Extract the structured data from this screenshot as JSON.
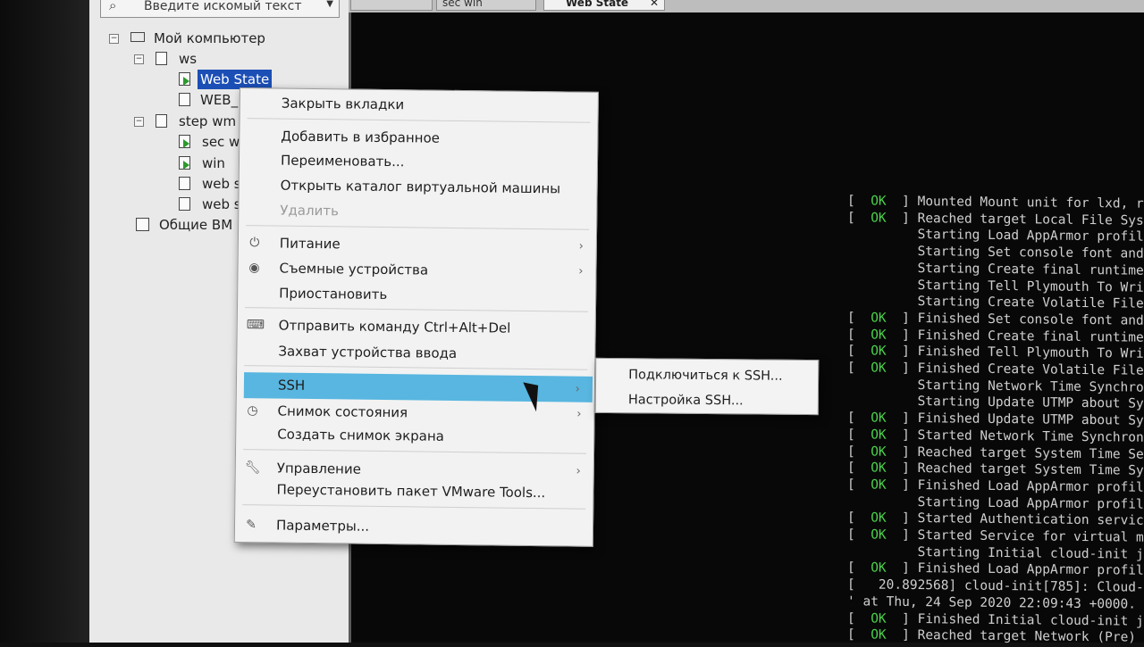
{
  "search": {
    "placeholder": "Введите искомый текст"
  },
  "tree": {
    "root": "Мой компьютер",
    "ws_folder": "ws",
    "ws_items": [
      "Web State",
      "WEB_"
    ],
    "stepwm_folder": "step wm",
    "stepwm_items": [
      "sec wi",
      "win",
      "web s",
      "web s"
    ],
    "shared": "Общие ВМ"
  },
  "tabs": [
    "",
    "sec win",
    "Web State"
  ],
  "context_menu": {
    "close_tabs": "Закрыть вкладки",
    "add_favorite": "Добавить в избранное",
    "rename": "Переименовать...",
    "open_dir": "Открыть каталог виртуальной машины",
    "delete": "Удалить",
    "power": "Питание",
    "removable": "Съемные устройства",
    "pause": "Приостановить",
    "send_cad": "Отправить команду Ctrl+Alt+Del",
    "grab_input": "Захват устройства ввода",
    "ssh": "SSH",
    "snapshot": "Снимок состояния",
    "screenshot": "Создать снимок экрана",
    "manage": "Управление",
    "reinstall_tools": "Переустановить пакет VMware Tools...",
    "settings": "Параметры..."
  },
  "ssh_submenu": {
    "connect": "Подключиться к SSH...",
    "configure": "Настройка SSH..."
  },
  "console_lines": [
    "[  OK  ] Mounted Mount unit for lxd, re",
    "[  OK  ] Reached target Local File Sys",
    "         Starting Load AppArmor profile",
    "         Starting Set console font and",
    "         Starting Create final runtime",
    "         Starting Tell Plymouth To Wri",
    "         Starting Create Volatile File",
    "[  OK  ] Finished Set console font and",
    "[  OK  ] Finished Create final runtime",
    "[  OK  ] Finished Tell Plymouth To Wri",
    "[  OK  ] Finished Create Volatile File",
    "         Starting Network Time Synchro",
    "         Starting Update UTMP about Sy",
    "[  OK  ] Finished Update UTMP about Sy",
    "[  OK  ] Started Network Time Synchron",
    "[  OK  ] Reached target System Time Se",
    "[  OK  ] Reached target System Time Sy",
    "[  OK  ] Finished Load AppArmor profil",
    "         Starting Load AppArmor profil",
    "[  OK  ] Started Authentication servic",
    "[  OK  ] Started Service for virtual m",
    "         Starting Initial cloud-init j",
    "[  OK  ] Finished Load AppArmor profil",
    "[   20.892568] cloud-init[785]: Cloud-",
    "' at Thu, 24 Sep 2020 22:09:43 +0000.",
    "[  OK  ] Finished Initial cloud-init j",
    "[  OK  ] Reached target Network (Pre)"
  ]
}
